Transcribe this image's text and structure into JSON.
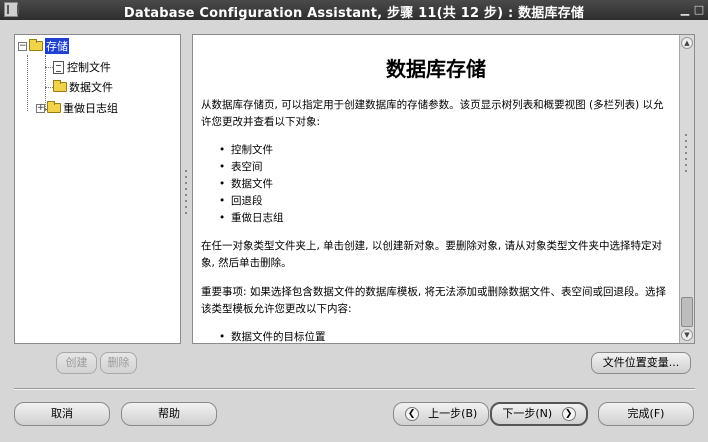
{
  "window": {
    "title": "Database Configuration Assistant, 步骤 11(共 12 步) : 数据库存储"
  },
  "tree": {
    "root": {
      "label": "存储",
      "expander": "−"
    },
    "items": [
      {
        "label": "控制文件",
        "icon": "document-icon"
      },
      {
        "label": "数据文件",
        "icon": "folder-icon"
      },
      {
        "label": "重做日志组",
        "icon": "folder-icon",
        "expander": "+"
      }
    ]
  },
  "help": {
    "heading": "数据库存储",
    "intro": "从数据库存储页, 可以指定用于创建数据库的存储参数。该页显示树列表和概要视图 (多栏列表) 以允许您更改并查看以下对象:",
    "objects": [
      "控制文件",
      "表空间",
      "数据文件",
      "回退段",
      "重做日志组"
    ],
    "create_delete_text": "在任一对象类型文件夹上, 单击创建, 以创建新对象。要删除对象, 请从对象类型文件夹中选择特定对象, 然后单击删除。",
    "important_text": "重要事项: 如果选择包含数据文件的数据库模板, 将无法添加或删除数据文件、表空间或回退段。选择该类型模板允许您更改以下内容:",
    "important_items": [
      "数据文件的目标位置"
    ]
  },
  "buttons": {
    "create": "创建",
    "delete": "删除",
    "file_location_vars": "文件位置变量...",
    "cancel": "取消",
    "help": "帮助",
    "back": "上一步(B)",
    "next": "下一步(N)",
    "finish": "完成(F)"
  },
  "colors": {
    "selection": "#1f3fcf",
    "titlebar": "#3a3a3a",
    "background": "#d6d6d6"
  }
}
